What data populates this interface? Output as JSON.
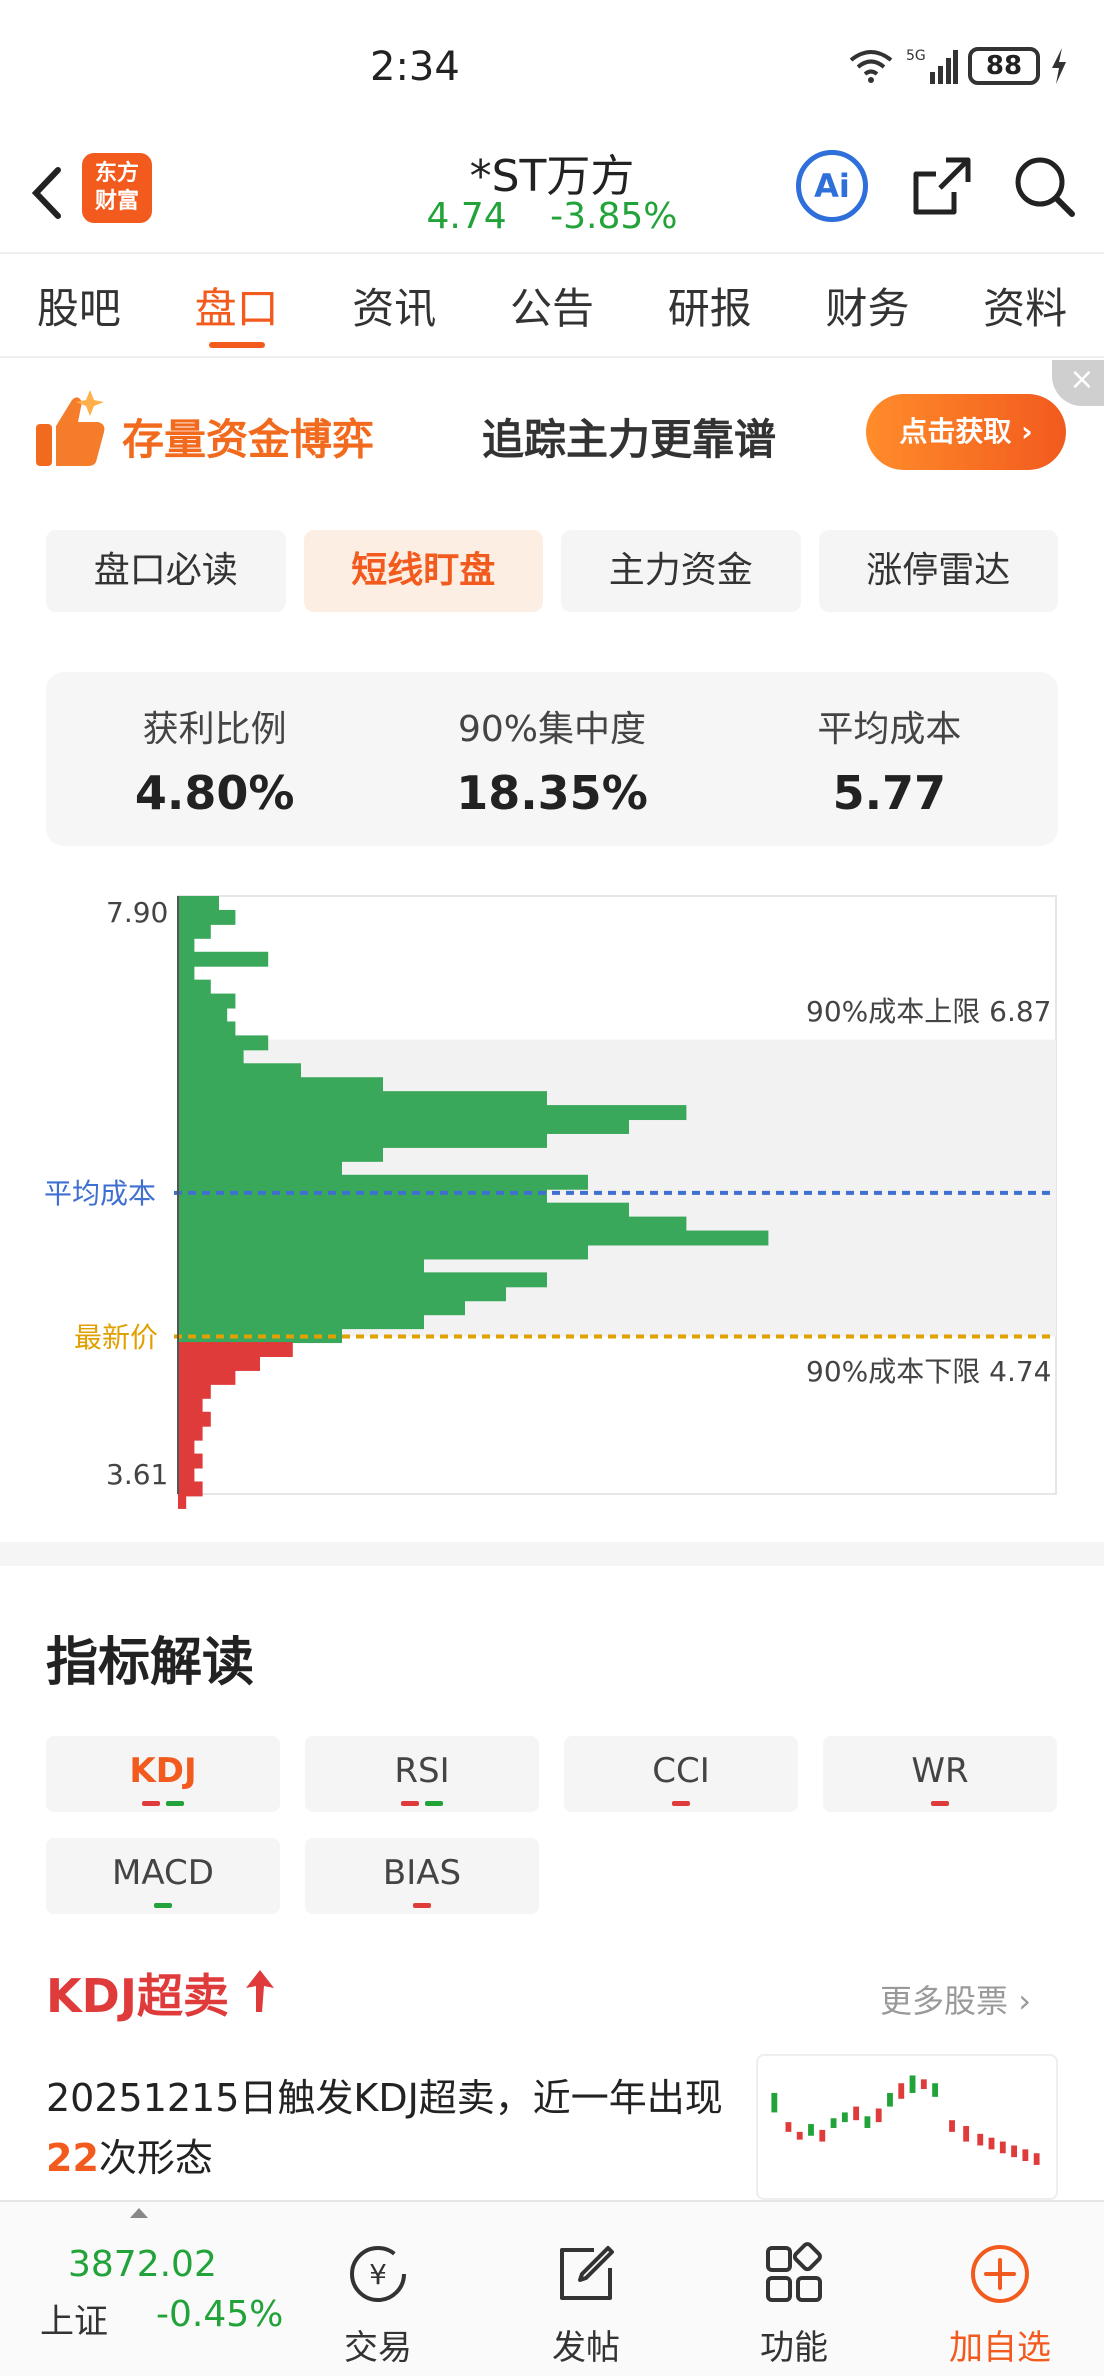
{
  "status_bar": {
    "time": "2:34",
    "network": "5G",
    "battery": "88"
  },
  "header": {
    "logo_line1": "东方",
    "logo_line2": "财富",
    "stock_name": "*ST万方",
    "price": "4.74",
    "change_pct": "-3.85%",
    "ai_label": "Ai"
  },
  "tabs": [
    "股吧",
    "盘口",
    "资讯",
    "公告",
    "研报",
    "财务",
    "资料"
  ],
  "active_tab": "盘口",
  "banner": {
    "title": "存量资金博弈",
    "subtitle": "追踪主力更靠谱",
    "button_label": "点击获取 ›",
    "close_label": "×"
  },
  "subtabs": [
    "盘口必读",
    "短线盯盘",
    "主力资金",
    "涨停雷达"
  ],
  "active_subtab": "短线盯盘",
  "stats": [
    {
      "label": "获利比例",
      "value": "4.80%"
    },
    {
      "label": "90%集中度",
      "value": "18.35%"
    },
    {
      "label": "平均成本",
      "value": "5.77"
    }
  ],
  "chip_chart": {
    "top_price": "7.90",
    "bottom_price": "3.61",
    "avg_cost_label": "平均成本",
    "latest_price_label": "最新价",
    "upper_limit_label": "90%成本上限 6.87",
    "lower_limit_label": "90%成本下限 4.74",
    "price_max": 7.9,
    "price_min": 3.61,
    "upper_limit": 6.87,
    "lower_limit": 4.74,
    "avg_cost": 5.77,
    "latest_price": 4.74,
    "colors": {
      "profit": "#e03b3b",
      "loss": "#3aa85a",
      "avg_line": "#3f6fd1",
      "latest_line": "#e0a000",
      "band": "#f2f2f2"
    }
  },
  "chart_data": {
    "type": "bar",
    "title": "",
    "orientation": "horizontal",
    "xlabel": "",
    "ylabel": "",
    "ylim": [
      3.61,
      7.9
    ],
    "series": [
      {
        "name": "",
        "color": "#3aa85a",
        "price": [
          7.9,
          7.8,
          7.7,
          7.6,
          7.5,
          7.4,
          7.3,
          7.2,
          7.1,
          7.0,
          6.9,
          6.8,
          6.7,
          6.6,
          6.5,
          6.4,
          6.3,
          6.2,
          6.1,
          6.0,
          5.9,
          5.8,
          5.7,
          5.6,
          5.5,
          5.4,
          5.3,
          5.2,
          5.1,
          5.0,
          4.9,
          4.8
        ],
        "values": [
          0.05,
          0.07,
          0.04,
          0.02,
          0.11,
          0.02,
          0.04,
          0.07,
          0.06,
          0.07,
          0.11,
          0.08,
          0.15,
          0.25,
          0.45,
          0.62,
          0.55,
          0.45,
          0.25,
          0.2,
          0.5,
          0.45,
          0.55,
          0.62,
          0.72,
          0.5,
          0.3,
          0.45,
          0.4,
          0.35,
          0.3,
          0.2
        ]
      },
      {
        "name": "",
        "color": "#e03b3b",
        "price": [
          4.7,
          4.6,
          4.5,
          4.4,
          4.3,
          4.2,
          4.1,
          4.0,
          3.9,
          3.8,
          3.7,
          3.61
        ],
        "values": [
          0.14,
          0.1,
          0.07,
          0.04,
          0.03,
          0.04,
          0.03,
          0.02,
          0.03,
          0.02,
          0.03,
          0.01
        ]
      }
    ]
  },
  "indicators": {
    "title": "指标解读",
    "buttons": [
      {
        "label": "KDJ",
        "dots": [
          "red",
          "green"
        ],
        "active": true
      },
      {
        "label": "RSI",
        "dots": [
          "red",
          "green"
        ],
        "active": false
      },
      {
        "label": "CCI",
        "dots": [
          "red"
        ],
        "active": false
      },
      {
        "label": "WR",
        "dots": [
          "red"
        ],
        "active": false
      },
      {
        "label": "MACD",
        "dots": [
          "green"
        ],
        "active": false
      },
      {
        "label": "BIAS",
        "dots": [
          "red"
        ],
        "active": false
      }
    ]
  },
  "kdj": {
    "heading": "KDJ超卖",
    "more_label": "更多股票",
    "desc_prefix": "20251215日触发KDJ超卖，近一年出现",
    "count": "22",
    "desc_suffix": "次形态"
  },
  "bottom_bar": {
    "index_value": "3872.02",
    "index_name": "上证",
    "index_change": "-0.45%",
    "nav": [
      {
        "label": "交易",
        "icon": "trade-yuan-icon"
      },
      {
        "label": "发帖",
        "icon": "post-edit-icon"
      },
      {
        "label": "功能",
        "icon": "functions-grid-icon"
      },
      {
        "label": "加自选",
        "icon": "add-watchlist-icon"
      }
    ]
  }
}
